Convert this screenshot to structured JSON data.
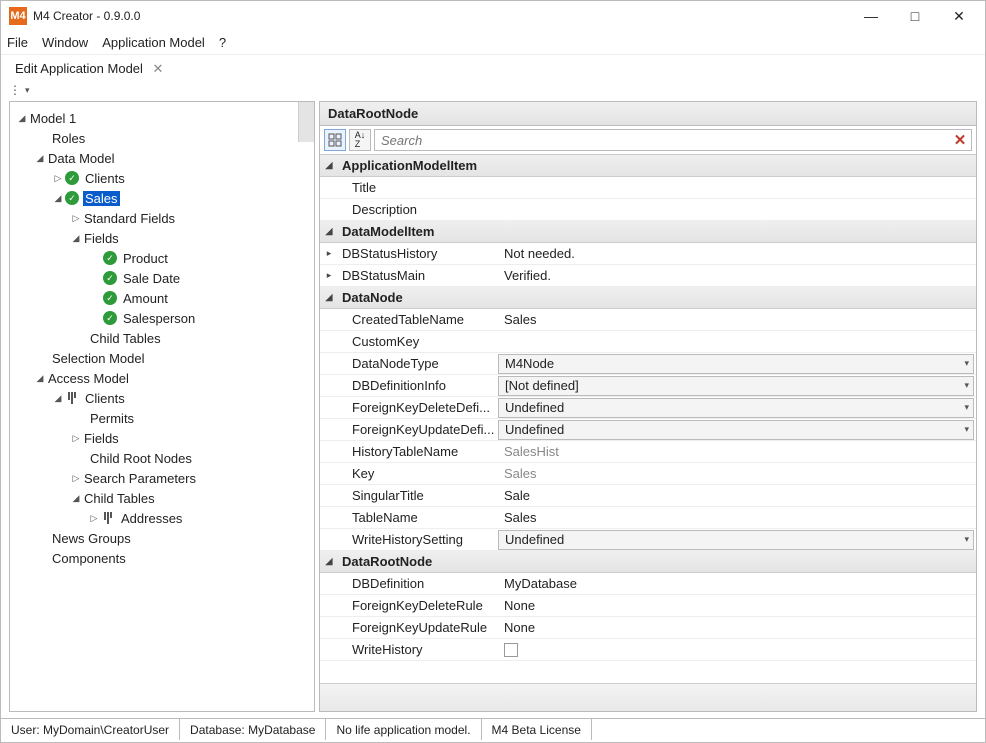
{
  "window": {
    "app_prefix": "M4",
    "title": "M4 Creator - 0.9.0.0"
  },
  "menu": {
    "file": "File",
    "window": "Window",
    "app_model": "Application Model",
    "help": "?"
  },
  "tab": {
    "label": "Edit Application Model"
  },
  "tree": {
    "model": "Model 1",
    "roles": "Roles",
    "data_model": "Data Model",
    "clients": "Clients",
    "sales": "Sales",
    "standard_fields": "Standard Fields",
    "fields": "Fields",
    "product": "Product",
    "sale_date": "Sale Date",
    "amount": "Amount",
    "salesperson": "Salesperson",
    "child_tables": "Child Tables",
    "selection_model": "Selection Model",
    "access_model": "Access Model",
    "am_clients": "Clients",
    "permits": "Permits",
    "am_fields": "Fields",
    "child_root_nodes": "Child Root Nodes",
    "search_params": "Search Parameters",
    "am_child_tables": "Child Tables",
    "addresses": "Addresses",
    "news_groups": "News Groups",
    "components": "Components"
  },
  "rp": {
    "header": "DataRootNode",
    "sort_az": "A↓Z",
    "search_placeholder": "Search"
  },
  "groups": {
    "ami": "ApplicationModelItem",
    "dmi": "DataModelItem",
    "dn": "DataNode",
    "drn": "DataRootNode"
  },
  "props": {
    "ami": {
      "title": {
        "label": "Title",
        "value": ""
      },
      "desc": {
        "label": "Description",
        "value": ""
      }
    },
    "dmi": {
      "dbsh": {
        "label": "DBStatusHistory",
        "value": "Not needed."
      },
      "dbsm": {
        "label": "DBStatusMain",
        "value": "Verified."
      }
    },
    "dn": {
      "ctn": {
        "label": "CreatedTableName",
        "value": "Sales"
      },
      "ck": {
        "label": "CustomKey",
        "value": ""
      },
      "dnt": {
        "label": "DataNodeType",
        "value": "M4Node"
      },
      "dbdi": {
        "label": "DBDefinitionInfo",
        "value": "[Not defined]"
      },
      "fkdd": {
        "label": "ForeignKeyDeleteDefi...",
        "value": "Undefined"
      },
      "fkud": {
        "label": "ForeignKeyUpdateDefi...",
        "value": "Undefined"
      },
      "htn": {
        "label": "HistoryTableName",
        "value": "SalesHist"
      },
      "key": {
        "label": "Key",
        "value": "Sales"
      },
      "st": {
        "label": "SingularTitle",
        "value": "Sale"
      },
      "tn": {
        "label": "TableName",
        "value": "Sales"
      },
      "whs": {
        "label": "WriteHistorySetting",
        "value": "Undefined"
      }
    },
    "drn": {
      "dbd": {
        "label": "DBDefinition",
        "value": "MyDatabase"
      },
      "fkdr": {
        "label": "ForeignKeyDeleteRule",
        "value": "None"
      },
      "fkur": {
        "label": "ForeignKeyUpdateRule",
        "value": "None"
      },
      "wh": {
        "label": "WriteHistory",
        "value": ""
      }
    }
  },
  "status": {
    "user": "User: MyDomain\\CreatorUser",
    "db": "Database: MyDatabase",
    "life": "No life application model.",
    "license": "M4 Beta License"
  }
}
